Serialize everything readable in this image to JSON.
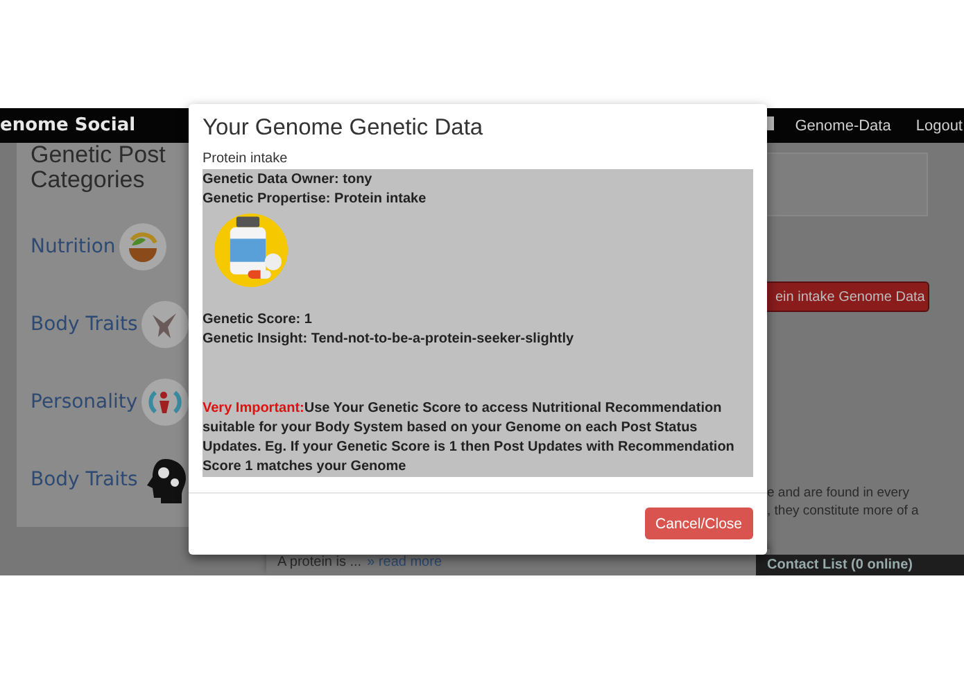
{
  "navbar": {
    "brand": "enome Social",
    "links": [
      "Genome-Data",
      "Logout"
    ]
  },
  "sidebar": {
    "heading": "Genetic Post Categories",
    "items": [
      {
        "label": "Nutrition"
      },
      {
        "label": "Body Traits"
      },
      {
        "label": "Personality"
      },
      {
        "label": "Body Traits"
      }
    ]
  },
  "background": {
    "data_button": "ein intake Genome Data",
    "text_lines": [
      "e and are found in every",
      ", they constitute more of a"
    ],
    "post_excerpt": {
      "text": "A protein is ...",
      "link": "» read more"
    },
    "contact_list": "Contact List (0 online)"
  },
  "modal": {
    "title": "Your Genome Genetic Data",
    "subtitle": "Protein intake",
    "owner": "Genetic Data Owner: tony",
    "property": "Genetic Propertise: Protein intake",
    "score": "Genetic Score: 1",
    "insight": "Genetic Insight: Tend-not-to-be-a-protein-seeker-slightly",
    "notice": {
      "label": "Very Important:",
      "text": "Use Your Genetic Score to access Nutritional Recommendation suitable for your Body System based on your Genome on each Post Status Updates. Eg. If your Genetic Score is 1 then Post Updates with Recommendation Score 1 matches your Genome"
    },
    "buttons": [
      "Cancel/Close"
    ]
  }
}
